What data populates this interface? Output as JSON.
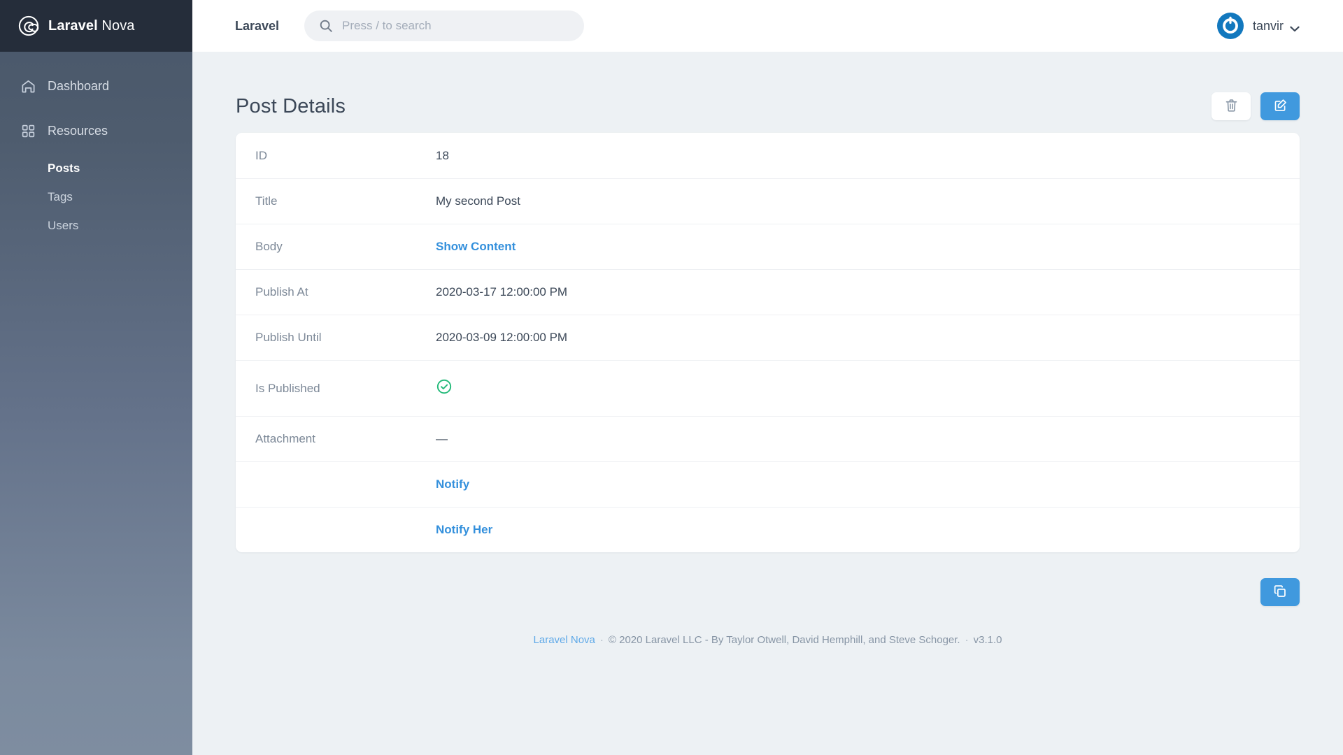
{
  "sidebar": {
    "logo_bold": "Laravel",
    "logo_light": "Nova",
    "logo_icon": "nova-spiral-logo-icon",
    "items": [
      {
        "label": "Dashboard",
        "icon": "home-icon"
      },
      {
        "label": "Resources",
        "icon": "grid-squares-icon"
      }
    ],
    "resources": [
      {
        "label": "Posts",
        "active": true
      },
      {
        "label": "Tags",
        "active": false
      },
      {
        "label": "Users",
        "active": false
      }
    ]
  },
  "topbar": {
    "brand": "Laravel",
    "search": {
      "placeholder": "Press / to search",
      "value": "",
      "icon": "search-icon"
    },
    "user": {
      "name": "tanvir",
      "avatar_icon": "gravatar-avatar",
      "chevron_icon": "chevron-down-icon"
    }
  },
  "page": {
    "title": "Post Details",
    "actions": [
      {
        "name": "delete",
        "icon": "trash-icon",
        "label": "Delete"
      },
      {
        "name": "edit",
        "icon": "pencil-square-icon",
        "label": "Edit"
      }
    ]
  },
  "detail_rows": [
    {
      "label": "ID",
      "value": "18",
      "type": "text"
    },
    {
      "label": "Title",
      "value": "My second Post",
      "type": "text"
    },
    {
      "label": "Body",
      "value": "Show Content",
      "type": "link"
    },
    {
      "label": "Publish At",
      "value": "2020-03-17 12:00:00 PM",
      "type": "text"
    },
    {
      "label": "Publish Until",
      "value": "2020-03-09 12:00:00 PM",
      "type": "text"
    },
    {
      "label": "Is Published",
      "value": "",
      "type": "boolean-true",
      "icon": "check-circle-icon"
    },
    {
      "label": "Attachment",
      "value": "—",
      "type": "text"
    },
    {
      "label": "",
      "value": "Notify",
      "type": "link"
    },
    {
      "label": "",
      "value": "Notify Her",
      "type": "link"
    }
  ],
  "fab": {
    "icon": "duplicate-copy-icon",
    "label": "Duplicate"
  },
  "footer": {
    "link": "Laravel Nova",
    "sep1": "·",
    "copyright": "© 2020 Laravel LLC - By Taylor Otwell, David Hemphill, and Steve Schoger.",
    "sep2": "·",
    "version": "v3.1.0"
  },
  "colors": {
    "accent_blue": "#4099de",
    "link_blue": "#3490dc",
    "success_green": "#21b978",
    "sidebar_dark": "#252d3a",
    "text_dark": "#3c4858",
    "text_muted": "#7c8897",
    "page_bg": "#edf1f4"
  }
}
